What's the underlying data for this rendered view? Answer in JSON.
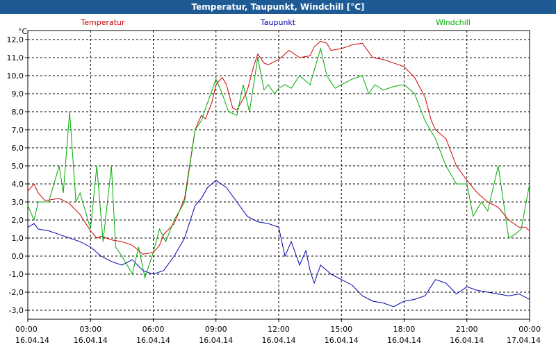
{
  "window": {
    "title": "Temperatur, Taupunkt, Windchill [°C]"
  },
  "chart_data": {
    "type": "line",
    "title": "Temperatur, Taupunkt, Windchill [°C]",
    "ylabel": "°C",
    "ylim": [
      -3.5,
      12.5
    ],
    "yticks": [
      12,
      11,
      10,
      9,
      8,
      7,
      6,
      5,
      4,
      3,
      2,
      1,
      0,
      -1,
      -2,
      -3
    ],
    "ytick_labels": [
      "12,0",
      "11,0",
      "10,0",
      "9,0",
      "8,0",
      "7,0",
      "6,0",
      "5,0",
      "4,0",
      "3,0",
      "2,0",
      "1,0",
      "0,0",
      "-1,0",
      "-2,0",
      "-3,0"
    ],
    "xlim": [
      0,
      24
    ],
    "xticks": [
      0,
      3,
      6,
      9,
      12,
      15,
      18,
      21,
      24
    ],
    "xtick_times": [
      "00:00",
      "03:00",
      "06:00",
      "09:00",
      "12:00",
      "15:00",
      "18:00",
      "21:00",
      "00:00"
    ],
    "xtick_dates": [
      "16.04.14",
      "16.04.14",
      "16.04.14",
      "16.04.14",
      "16.04.14",
      "16.04.14",
      "16.04.14",
      "16.04.14",
      "17.04.14"
    ],
    "grid": true,
    "series": [
      {
        "name": "Temperatur",
        "color": "#cc0000",
        "x": [
          0,
          0.3,
          0.5,
          0.8,
          1,
          1.5,
          2,
          2.5,
          3,
          3.3,
          3.5,
          4,
          4.5,
          5,
          5.5,
          6,
          6.3,
          6.5,
          7,
          7.5,
          8,
          8.3,
          8.5,
          8.8,
          9,
          9.3,
          9.5,
          9.8,
          10,
          10.3,
          10.5,
          10.8,
          11,
          11.3,
          11.5,
          12,
          12.5,
          13,
          13.5,
          13.7,
          14,
          14.3,
          14.5,
          15,
          15.5,
          16,
          16.5,
          17,
          17.5,
          18,
          18.5,
          19,
          19.3,
          19.5,
          20,
          20.5,
          21,
          21.5,
          22,
          22.5,
          23,
          23.5,
          23.8,
          24
        ],
        "values": [
          3.6,
          4.0,
          3.5,
          3.1,
          3.1,
          3.2,
          2.9,
          2.3,
          1.4,
          1.0,
          1.1,
          0.9,
          0.8,
          0.6,
          0.1,
          0.2,
          0.6,
          1.2,
          1.8,
          3.2,
          7.0,
          7.8,
          7.6,
          8.5,
          9.5,
          9.9,
          9.5,
          8.2,
          8.1,
          8.7,
          9.2,
          10.5,
          11.2,
          10.7,
          10.6,
          10.9,
          11.4,
          11.0,
          11.1,
          11.6,
          11.9,
          11.8,
          11.4,
          11.5,
          11.7,
          11.8,
          11.0,
          10.9,
          10.7,
          10.5,
          9.9,
          8.8,
          7.5,
          7.0,
          6.5,
          5.0,
          4.2,
          3.5,
          3.0,
          2.7,
          2.0,
          1.6,
          1.6,
          1.4
        ]
      },
      {
        "name": "Taupunkt",
        "color": "#0000aa",
        "x": [
          0,
          0.3,
          0.5,
          1,
          1.5,
          2,
          2.5,
          3,
          3.5,
          4,
          4.5,
          5,
          5.5,
          6,
          6.5,
          7,
          7.5,
          8,
          8.3,
          8.6,
          9,
          9.5,
          10,
          10.5,
          11,
          11.5,
          12,
          12.3,
          12.6,
          13,
          13.3,
          13.5,
          13.7,
          14,
          14.5,
          15,
          15.5,
          16,
          16.5,
          17,
          17.5,
          18,
          18.5,
          19,
          19.5,
          20,
          20.5,
          21,
          21.5,
          22,
          22.5,
          23,
          23.5,
          24
        ],
        "values": [
          1.6,
          1.8,
          1.5,
          1.4,
          1.2,
          1.0,
          0.8,
          0.5,
          0.0,
          -0.3,
          -0.5,
          -0.2,
          -0.8,
          -1.0,
          -0.8,
          0.0,
          1.0,
          2.8,
          3.2,
          3.8,
          4.2,
          3.8,
          3.0,
          2.2,
          1.9,
          1.8,
          1.6,
          0.0,
          0.8,
          -0.5,
          0.3,
          -0.8,
          -1.5,
          -0.5,
          -1.0,
          -1.3,
          -1.6,
          -2.2,
          -2.5,
          -2.6,
          -2.8,
          -2.5,
          -2.4,
          -2.2,
          -1.3,
          -1.5,
          -2.1,
          -1.7,
          -1.9,
          -2.0,
          -2.1,
          -2.2,
          -2.1,
          -2.4
        ]
      },
      {
        "name": "Windchill",
        "color": "#00aa00",
        "x": [
          0,
          0.3,
          0.5,
          1,
          1.5,
          1.7,
          2,
          2.3,
          2.5,
          3,
          3.3,
          3.6,
          4,
          4.2,
          4.5,
          5,
          5.3,
          5.6,
          6,
          6.3,
          6.6,
          7,
          7.5,
          8,
          8.3,
          8.6,
          9,
          9.3,
          9.6,
          10,
          10.3,
          10.6,
          11,
          11.3,
          11.5,
          11.8,
          12,
          12.3,
          12.6,
          13,
          13.5,
          14,
          14.3,
          14.7,
          15,
          15.5,
          16,
          16.3,
          16.6,
          17,
          17.5,
          18,
          18.5,
          19,
          19.5,
          20,
          20.5,
          21,
          21.3,
          21.7,
          22,
          22.5,
          23,
          23.3,
          23.6,
          24
        ],
        "values": [
          2.8,
          2.0,
          3.0,
          3.0,
          5.0,
          3.5,
          8.0,
          3.0,
          3.5,
          1.5,
          5.0,
          0.8,
          5.0,
          0.5,
          0.0,
          -1.0,
          0.5,
          -1.2,
          0.2,
          1.5,
          0.8,
          2.0,
          3.0,
          7.0,
          7.5,
          8.5,
          9.8,
          9.0,
          8.0,
          7.8,
          9.5,
          8.0,
          11.0,
          9.2,
          9.5,
          9.0,
          9.3,
          9.5,
          9.3,
          10.0,
          9.5,
          11.5,
          10.0,
          9.3,
          9.5,
          9.8,
          10.0,
          9.0,
          9.5,
          9.2,
          9.4,
          9.5,
          9.0,
          7.5,
          6.5,
          5.0,
          4.0,
          4.0,
          2.2,
          3.0,
          2.5,
          5.0,
          1.0,
          1.2,
          1.5,
          4.0
        ]
      }
    ]
  }
}
